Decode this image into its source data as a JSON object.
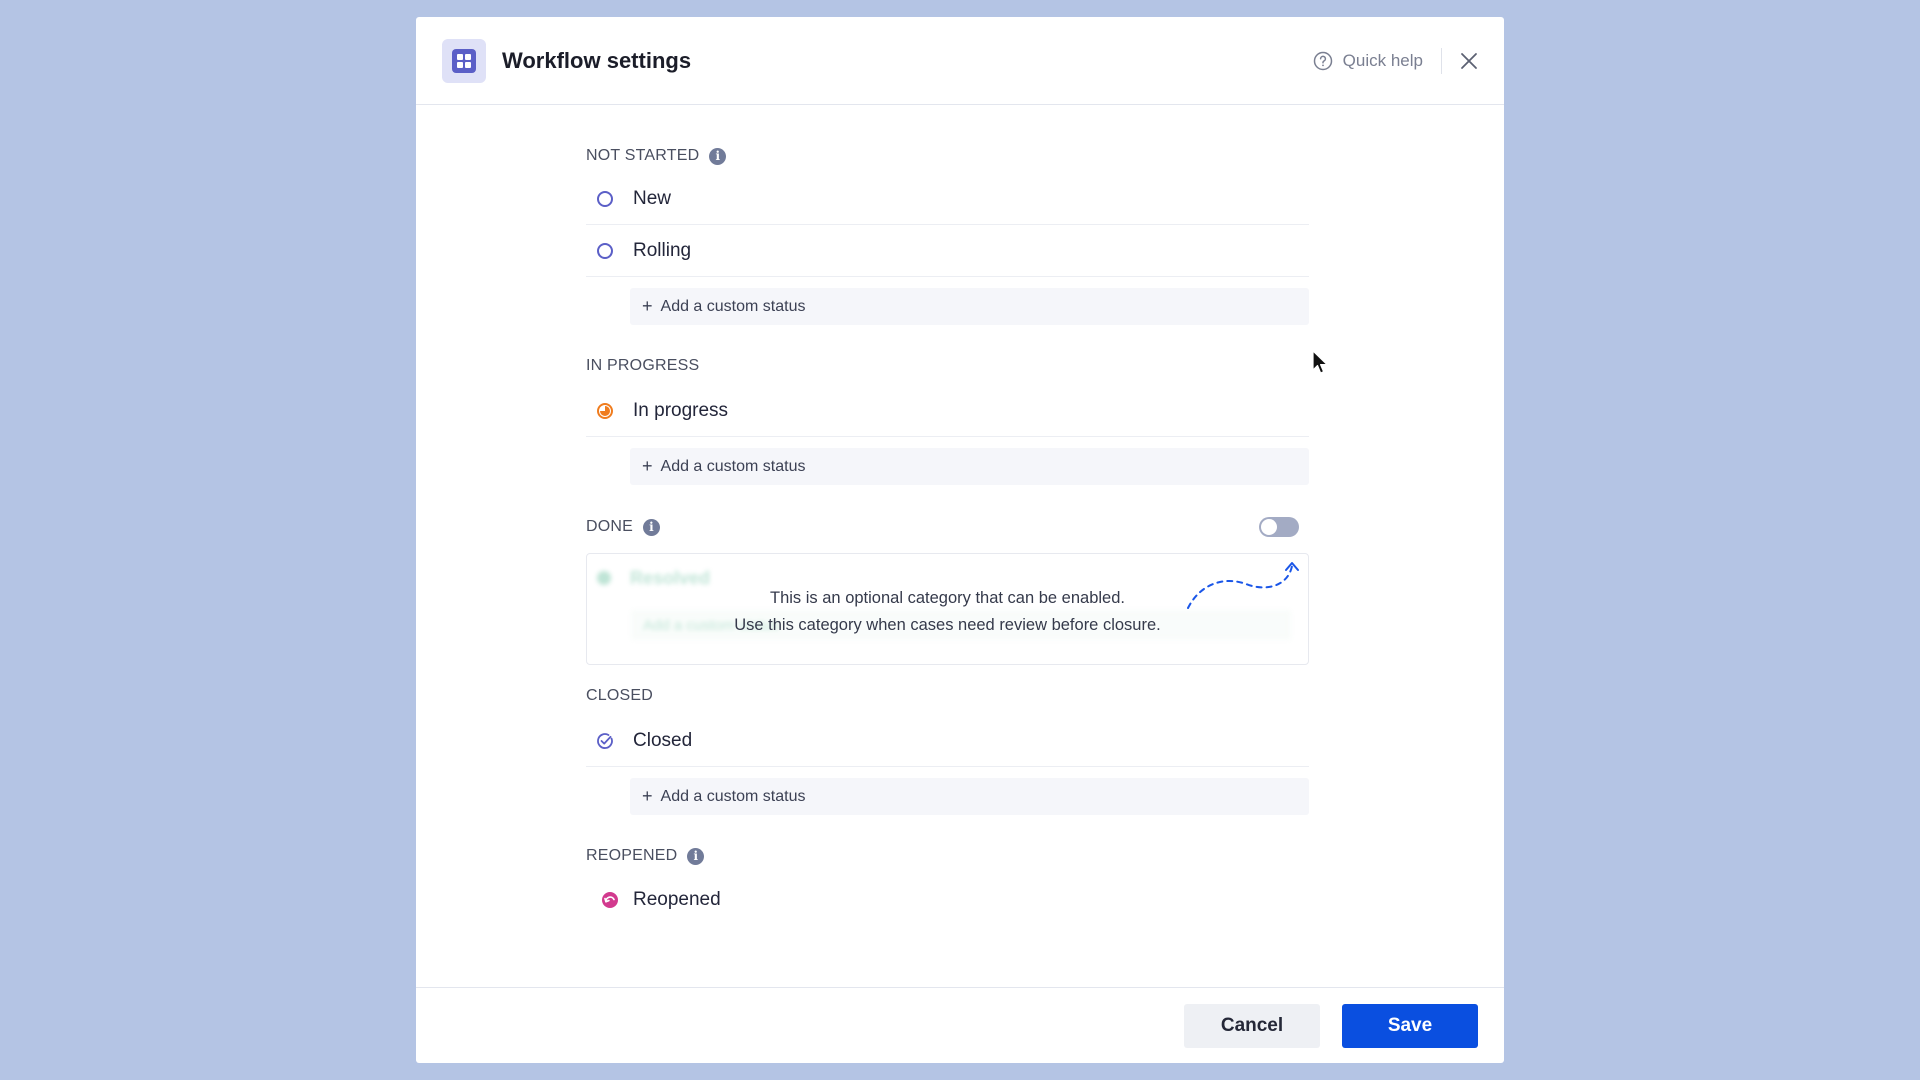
{
  "modal": {
    "title": "Workflow settings",
    "quick_help_label": "Quick help",
    "app_icon": "grid-app-icon",
    "close_icon": "close-icon",
    "help_icon": "question-circle-icon"
  },
  "categories": {
    "not_started": {
      "heading": "NOT STARTED",
      "statuses": [
        "New",
        "Rolling"
      ],
      "add_label": "Add a custom status"
    },
    "in_progress": {
      "heading": "IN PROGRESS",
      "statuses": [
        "In progress"
      ],
      "add_label": "Add a custom status"
    },
    "done": {
      "heading": "DONE",
      "enabled": false,
      "disabled_status": "Resolved",
      "disabled_add_label": "Add a custom status",
      "message_line1": "This is an optional category that can be enabled.",
      "message_line2": "Use this category when cases need review before closure."
    },
    "closed": {
      "heading": "CLOSED",
      "statuses": [
        "Closed"
      ],
      "add_label": "Add a custom status"
    },
    "reopened": {
      "heading": "REOPENED",
      "statuses": [
        "Reopened"
      ]
    }
  },
  "footer": {
    "cancel_label": "Cancel",
    "save_label": "Save"
  },
  "colors": {
    "accent": "#0a4fe0",
    "not_started_icon": "#5b5fc7",
    "in_progress_icon": "#f07c1e",
    "closed_icon": "#5b5fc7",
    "reopened_icon": "#d23a8e",
    "background": "#b4c4e4"
  }
}
